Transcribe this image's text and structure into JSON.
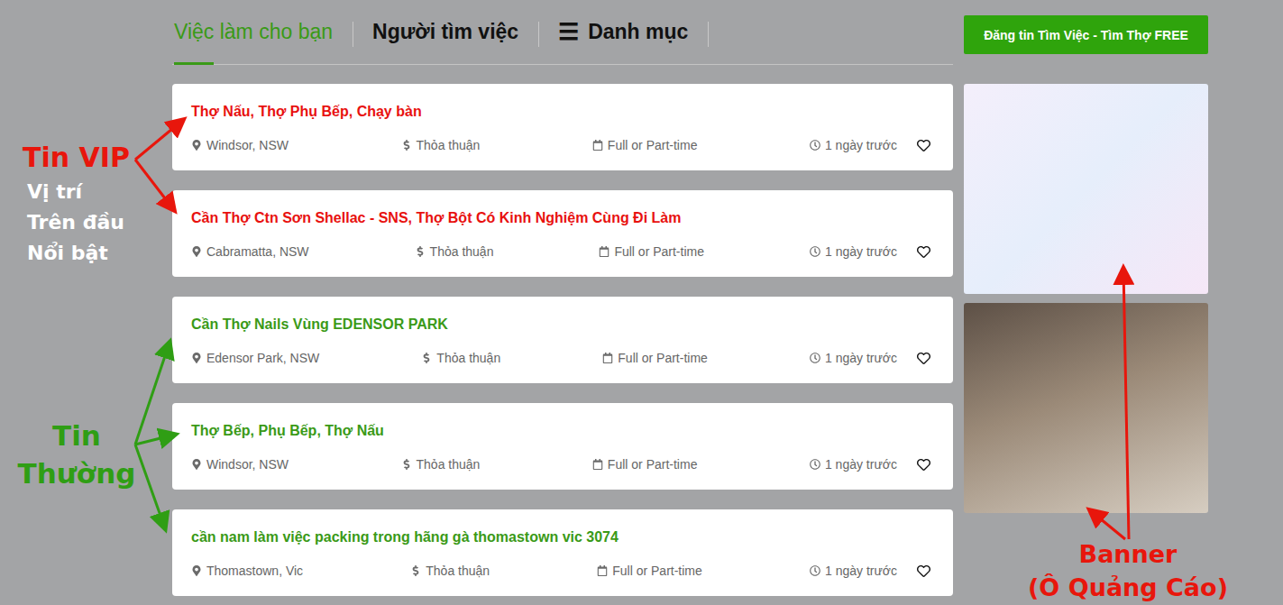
{
  "tabs": [
    {
      "label": "Việc làm cho bạn",
      "icon": "",
      "selected": true
    },
    {
      "label": "Người tìm việc",
      "icon": "",
      "selected": false
    },
    {
      "label": "Danh mục",
      "icon": "☰",
      "selected": false
    }
  ],
  "post_button": "Đăng tin Tìm Việc - Tìm Thợ FREE",
  "jobs": [
    {
      "kind": "vip",
      "title": "Thợ Nấu, Thợ Phụ Bếp, Chạy bàn",
      "location": "Windsor, NSW",
      "salary": "Thỏa thuận",
      "schedule": "Full or Part-time",
      "posted": "1 ngày trước",
      "saved": false
    },
    {
      "kind": "vip",
      "title": "Cần Thợ Ctn Sơn Shellac - SNS, Thợ Bột Có Kinh Nghiệm Cùng Đi Làm",
      "location": "Cabramatta, NSW",
      "salary": "Thỏa thuận",
      "schedule": "Full or Part-time",
      "posted": "1 ngày trước",
      "saved": false
    },
    {
      "kind": "normal",
      "title": "Cần Thợ Nails Vùng EDENSOR PARK",
      "location": "Edensor Park, NSW",
      "salary": "Thỏa thuận",
      "schedule": "Full or Part-time",
      "posted": "1 ngày trước",
      "saved": false
    },
    {
      "kind": "normal",
      "title": "Thợ Bếp, Phụ Bếp, Thợ Nấu",
      "location": "Windsor, NSW",
      "salary": "Thỏa thuận",
      "schedule": "Full or Part-time",
      "posted": "1 ngày trước",
      "saved": false
    },
    {
      "kind": "normal",
      "title": "cần nam làm việc packing trong hãng gà thomastown vic 3074",
      "location": "Thomastown, Vic",
      "salary": "Thỏa thuận",
      "schedule": "Full or Part-time",
      "posted": "1 ngày trước",
      "saved": false
    }
  ],
  "banners": [
    {
      "kind": "ad-image"
    },
    {
      "kind": "photo"
    }
  ],
  "annotations": {
    "vip": "Tin VIP",
    "vip_note": [
      "Vị trí",
      "Trên đầu",
      "Nổi bật"
    ],
    "normal": [
      "Tin",
      "Thường"
    ],
    "banner": [
      "Banner",
      "(Ô Quảng Cáo)"
    ]
  }
}
